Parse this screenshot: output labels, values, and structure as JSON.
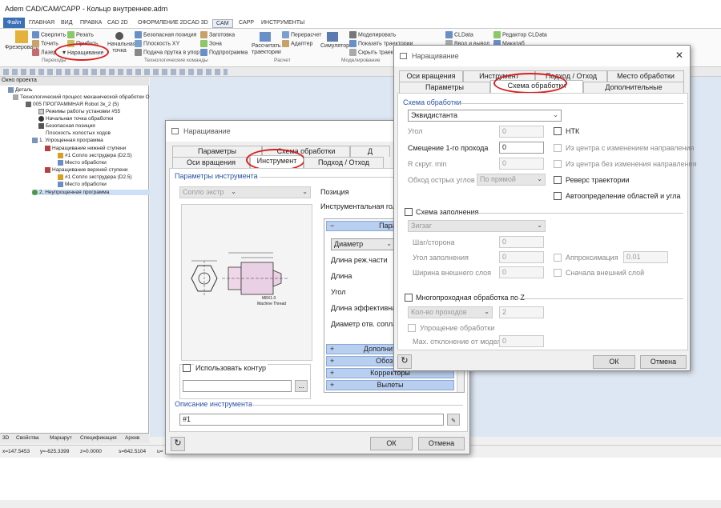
{
  "app": {
    "title": "Adem CAD/CAM/CAPP - Кольцо внутреннее.adm",
    "file_tab": "Файл",
    "ribbon_tabs": [
      "ГЛАВНАЯ",
      "ВИД",
      "ПРАВКА",
      "CAD 2D",
      "ОФОРМЛЕНИЕ 2D",
      "CAD 3D",
      "CAM",
      "CAPP",
      "ИНСТРУМЕНТЫ"
    ],
    "ribbon": {
      "mill": "Фрезеровать",
      "drill": "Сверлить",
      "turn": "Точить",
      "laser": "Лазер",
      "cut": "Резать",
      "bend": "Прибить",
      "build_up": "Наращивание",
      "start_point": "Начальная точка",
      "safe_pos": "Безопасная позиция",
      "plane_xy": "Плоскость XY",
      "feed_bar": "Подача прутка в упор",
      "blank": "Заготовка",
      "zone": "Зона",
      "subprogram": "Подпрограмма",
      "calc_path": "Рассчитать траектории",
      "recalc": "Перерасчет",
      "adapter": "Адаптер",
      "simulator": "Симулятор",
      "model": "Моделировать",
      "show_paths": "Показать траектории",
      "hide_paths": "Скрыть траектории",
      "cldata": "CLData",
      "editor_cldata": "Редактор CLData",
      "input_output": "Ввод и вывод",
      "macro": "Макатаб",
      "groups": [
        "Переходы",
        "Технологические команды",
        "Расчет",
        "Моделирование"
      ]
    },
    "tree": {
      "header": "Окно проекта",
      "items": [
        "Деталь",
        "Технологический процесс механической обработки  Обоз",
        "005 ПРОГРАММНАЯ Robot 3к_2 (5)",
        "Режимы работы установки #55",
        "Начальная точка обработки",
        "Безопасная позиция",
        "Плоскость холостых ходов",
        "1. Упрощенная программа",
        "Наращивание нижней ступени",
        "#1 Сопло экструдера (D2.5)",
        "Место обработки",
        "Наращивание верхней ступени",
        "#1 Сопло экструдера (D2.5)",
        "Место обработки",
        "2. Неупрощенная программа"
      ]
    },
    "bottom_tabs": [
      "3D",
      "Свойства",
      "Маршрут",
      "Спецификация",
      "Архив"
    ],
    "status": [
      "x=147.5453",
      "y=-625.3399",
      "z=0.0000",
      "s=642.5104",
      "u="
    ]
  },
  "dialog_back": {
    "title": "Наращивание",
    "tabs_row1": [
      "Параметры",
      "Схема обработки",
      "Д"
    ],
    "tabs_row2": [
      "Оси вращения",
      "Инструмент",
      "Подход / Отход"
    ],
    "section_tool_params": "Параметры инструмента",
    "tool_select": "Сопло экстр",
    "position_label": "Позиция",
    "tool_head_label": "Инструментальная гол",
    "params_header": "Парам",
    "param_dropdown": "Диаметр",
    "params": [
      "Длина реж.части",
      "Длина",
      "Угол",
      "Длина эффективная",
      "Диаметр отв. сопла"
    ],
    "groups": [
      "Дополнительны",
      "Обознач",
      "Корректоры",
      "Вылеты"
    ],
    "drawing_note": "М8X1.0",
    "drawing_note2": "Machine Thread",
    "use_contour": "Использовать контур",
    "contour_browse": "...",
    "section_desc": "Описание инструмента",
    "description": "#1",
    "ok": "ОК",
    "cancel": "Отмена"
  },
  "dialog_front": {
    "title": "Наращивание",
    "tabs_row1": [
      "Оси вращения",
      "Инструмент",
      "Подход / Отход",
      "Место обработки"
    ],
    "tabs_row2": [
      "Параметры",
      "Схема обработки",
      "Дополнительные"
    ],
    "section_scheme": "Схема обработки",
    "scheme_value": "Эквидистанта",
    "angle_label": "Угол",
    "angle_value": "0",
    "offset_label": "Смещение 1-го прохода",
    "offset_value": "0",
    "rmin_label": "R скруг. min",
    "rmin_value": "0",
    "corner_label": "Обход острых углов",
    "corner_value": "По прямой",
    "ntk": "НТК",
    "from_center_dir": "Из центра с изменением направления",
    "from_center_nodir": "Из центра без изменения направления",
    "reverse": "Реверс траектории",
    "auto_areas": "Автоопределение областей и угла",
    "fill_scheme": "Схема заполнения",
    "fill_value": "Зигзаг",
    "step_label": "Шаг/сторона",
    "step_value": "0",
    "fill_angle_label": "Угол заполнения",
    "fill_angle_value": "0",
    "outer_width_label": "Ширина внешнего слоя",
    "outer_width_value": "0",
    "approx": "Аппроксимация",
    "approx_value": "0.01",
    "outer_first": "Сначала внешний слой",
    "multipass": "Многопроходная обработка по Z",
    "passes_select": "Кол-во проходов",
    "passes_value": "2",
    "simplify": "Упрощение обработки",
    "max_dev_label": "Мах. отклонение от модели",
    "max_dev_value": "0",
    "ok": "ОК",
    "cancel": "Отмена"
  },
  "colors": {
    "accent": "#3b6fb6",
    "highlight_ring": "#d81f1f",
    "group_bar": "#b9cff0"
  }
}
